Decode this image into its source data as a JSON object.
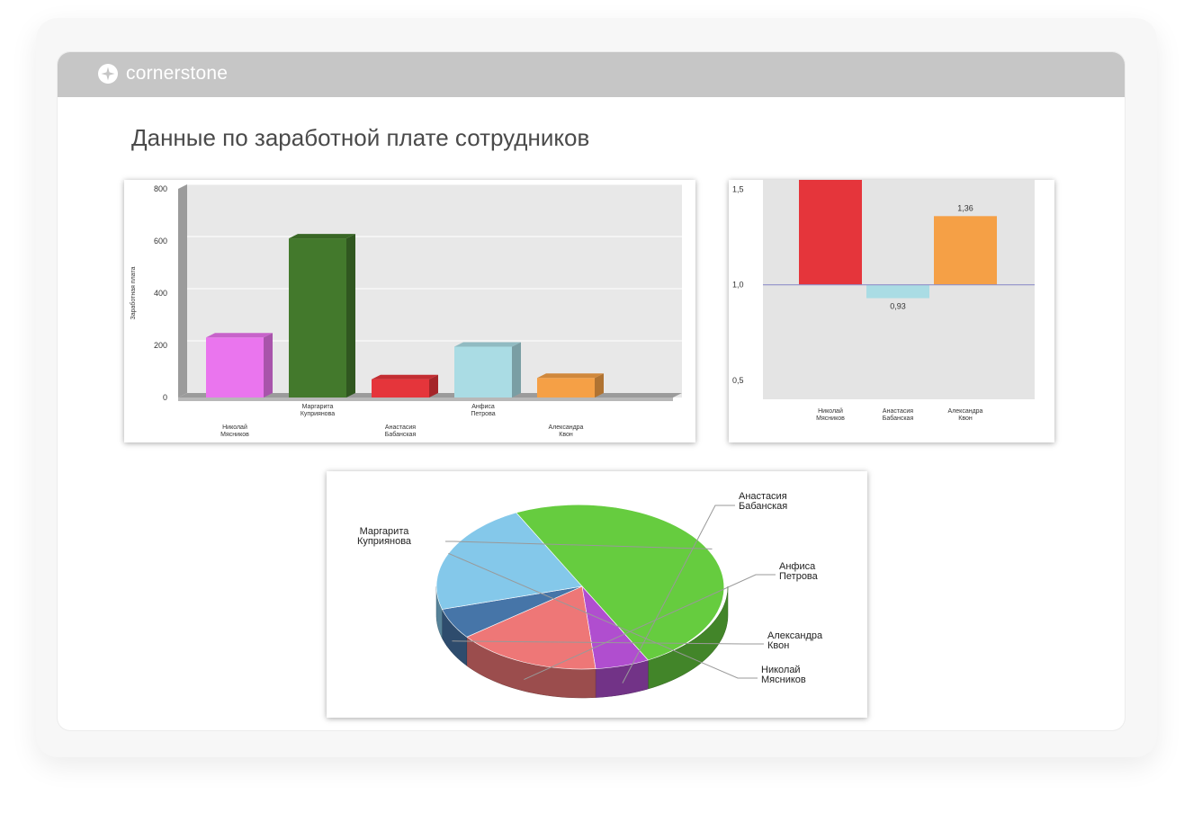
{
  "brand": {
    "name": "cornerstone",
    "icon": "cornerstone-logo-icon"
  },
  "page": {
    "title": "Данные по заработной плате сотрудников"
  },
  "chart_data": [
    {
      "type": "bar",
      "title": "",
      "ylabel": "Заработная плата",
      "xlabel": "",
      "ylim": [
        0,
        800
      ],
      "yticks": [
        0,
        200,
        400,
        600,
        800
      ],
      "grid": true,
      "categories": [
        [
          "Николай",
          "Мясников"
        ],
        [
          "Маргарита",
          "Куприянова"
        ],
        [
          "Анастасия",
          "Бабанская"
        ],
        [
          "Анфиса",
          "Петрова"
        ],
        [
          "Александра",
          "Квон"
        ]
      ],
      "values": [
        230,
        610,
        70,
        195,
        75
      ],
      "colors": [
        "#ea75ee",
        "#43792c",
        "#e5353b",
        "#aadce4",
        "#f5a046"
      ]
    },
    {
      "type": "bar",
      "title": "",
      "baseline": 1.0,
      "ylim": [
        0.4,
        1.55
      ],
      "yticks": [
        "1,5",
        "1,0",
        "0,5"
      ],
      "ytick_values": [
        1.5,
        1.0,
        0.5
      ],
      "categories": [
        [
          "Николай",
          "Мясников"
        ],
        [
          "Анастасия",
          "Бабанская"
        ],
        [
          "Александра",
          "Квон"
        ]
      ],
      "values": [
        1.55,
        0.93,
        1.36
      ],
      "data_labels": [
        "",
        "0,93",
        "1,36"
      ],
      "colors": [
        "#e5353b",
        "#aadce4",
        "#f5a046"
      ]
    },
    {
      "type": "pie",
      "title": "",
      "labels": [
        [
          "Маргарита",
          "Куприянова"
        ],
        [
          "Анастасия",
          "Бабанская"
        ],
        [
          "Анфиса",
          "Петрова"
        ],
        [
          "Александра",
          "Квон"
        ],
        [
          "Николай",
          "Мясников"
        ]
      ],
      "values": [
        50,
        6,
        16,
        6,
        22
      ],
      "colors": [
        "#66cc3f",
        "#b04ecf",
        "#ee7777",
        "#4675a8",
        "#84c8ea"
      ]
    }
  ]
}
